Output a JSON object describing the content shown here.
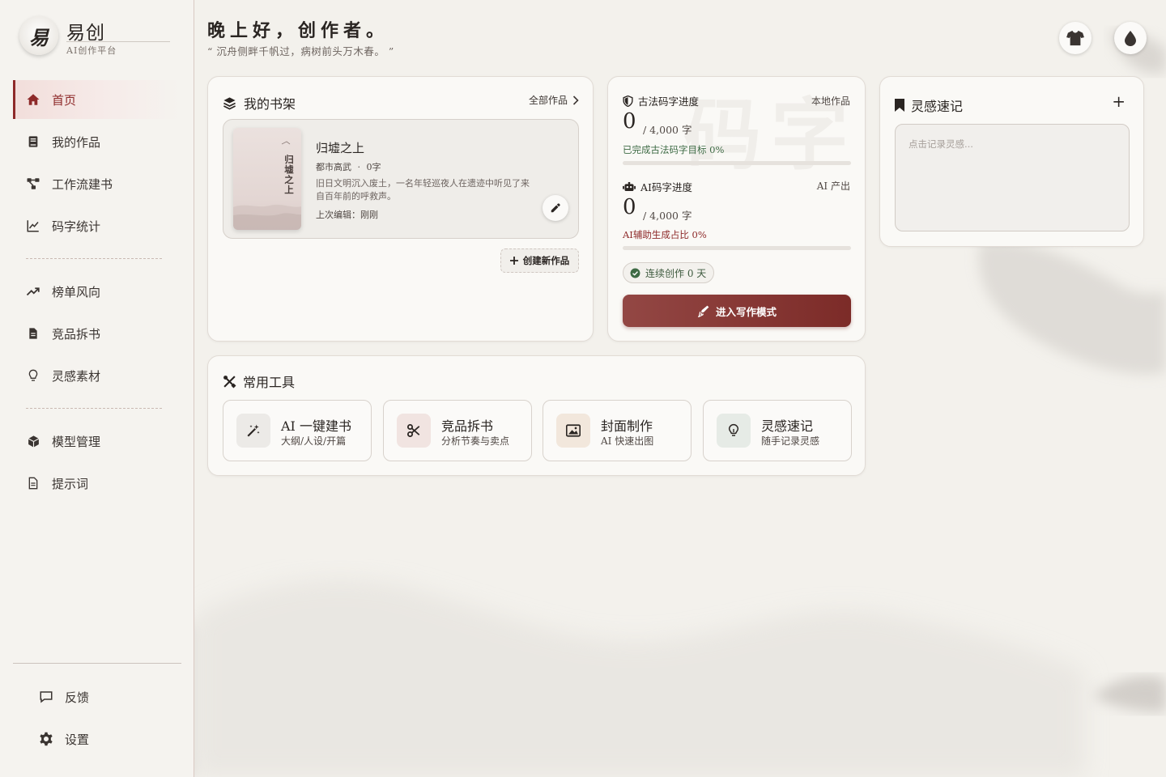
{
  "app": {
    "name": "易创",
    "subtitle": "AI创作平台",
    "logo_char": "易"
  },
  "sidebar": {
    "items": [
      {
        "label": "首页",
        "icon": "home-icon",
        "active": true
      },
      {
        "label": "我的作品",
        "icon": "book-icon"
      },
      {
        "label": "工作流建书",
        "icon": "workflow-icon"
      },
      {
        "label": "码字统计",
        "icon": "chart-line-icon"
      },
      {
        "label": "榜单风向",
        "icon": "trend-icon"
      },
      {
        "label": "竞品拆书",
        "icon": "document-icon"
      },
      {
        "label": "灵感素材",
        "icon": "lightbulb-icon"
      },
      {
        "label": "模型管理",
        "icon": "cube-icon"
      },
      {
        "label": "提示词",
        "icon": "file-icon"
      }
    ],
    "bottom": [
      {
        "label": "反馈",
        "icon": "chat-icon"
      },
      {
        "label": "设置",
        "icon": "gear-icon"
      }
    ]
  },
  "header": {
    "greeting": "晚上好，创作者。",
    "quote": "“ 沉舟侧畔千帆过，病树前头万木春。 ”",
    "buttons": [
      {
        "icon": "shirt-icon"
      },
      {
        "icon": "ink-drop-icon"
      }
    ]
  },
  "bookshelf": {
    "title": "我的书架",
    "all_link": "全部作品",
    "book": {
      "title": "归墟之上",
      "cover_title": "归墟之上",
      "genre": "都市高武",
      "separator": "·",
      "words": "0字",
      "description": "旧日文明沉入废土，一名年轻巡夜人在遗迹中听见了来自百年前的呼救声。",
      "last_edit": "上次编辑：刚刚"
    },
    "create_button": "创建新作品"
  },
  "progress": {
    "watermark": "码字",
    "classic": {
      "label": "古法码字进度",
      "right": "本地作品",
      "count": "0",
      "total": "/ 4,000 字",
      "percent_text": "已完成古法码字目标 0%",
      "percent": 0,
      "color": "#3e6b45"
    },
    "ai": {
      "label": "AI码字进度",
      "right": "AI 产出",
      "count": "0",
      "total": "/ 4,000 字",
      "percent_text": "AI辅助生成占比 0%",
      "percent": 0,
      "color": "#8e2a2a"
    },
    "streak": "连续创作 0 天",
    "write_button": "进入写作模式"
  },
  "inspiration": {
    "title": "灵感速记",
    "add": "+",
    "placeholder": "点击记录灵感..."
  },
  "tools": {
    "title": "常用工具",
    "items": [
      {
        "name": "AI 一键建书",
        "desc": "大纲/人设/开篇",
        "icon": "magic-wand-icon",
        "bg": "#eceae7"
      },
      {
        "name": "竞品拆书",
        "desc": "分析节奏与卖点",
        "icon": "scissors-icon",
        "bg": "#f1e4e1"
      },
      {
        "name": "封面制作",
        "desc": "AI 快速出图",
        "icon": "image-icon",
        "bg": "#f2e7dc"
      },
      {
        "name": "灵感速记",
        "desc": "随手记录灵感",
        "icon": "lightbulb-icon",
        "bg": "#e6ebe6"
      }
    ]
  },
  "colors": {
    "accent": "#8e2a2a",
    "background": "#f3f1ec",
    "card": "#faf9f6"
  }
}
